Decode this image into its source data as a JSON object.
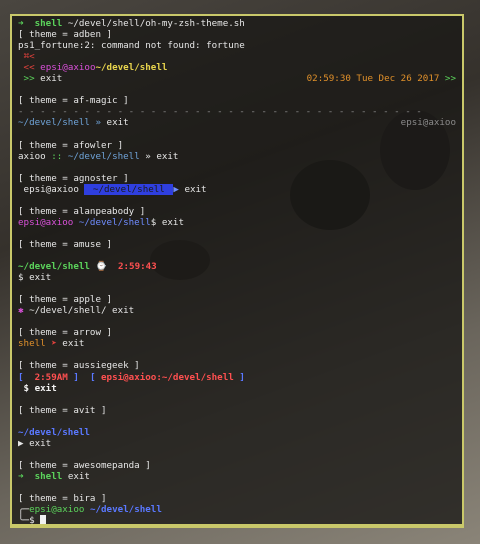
{
  "colors": {
    "frame": "#c9c86a",
    "accent_green": "#5bd35b",
    "accent_blue": "#5a78ff"
  },
  "lines": [
    {
      "segs": [
        {
          "t": "➜  ",
          "c": "g"
        },
        {
          "t": "shell",
          "c": "gb"
        },
        {
          "t": " ~/devel/shell/oh-my-zsh-theme.sh",
          "c": "w"
        }
      ]
    },
    {
      "segs": [
        {
          "t": "[ theme = adben ]",
          "c": "w"
        }
      ]
    },
    {
      "segs": [
        {
          "t": "ps1_fortune:2: command not found: fortune",
          "c": "w"
        }
      ]
    },
    {
      "segs": [
        {
          "t": " ",
          "c": "w"
        },
        {
          "t": "⌘<",
          "c": "r"
        }
      ]
    },
    {
      "segs": [
        {
          "t": " ",
          "c": "w"
        },
        {
          "t": "<<",
          "c": "r"
        },
        {
          "t": " epsi@axioo",
          "c": "m"
        },
        {
          "t": "~/devel/shell",
          "c": "y"
        }
      ]
    },
    {
      "segs": [
        {
          "t": " ",
          "c": "w"
        },
        {
          "t": ">>",
          "c": "g"
        },
        {
          "t": " exit",
          "c": "w"
        }
      ],
      "right": [
        {
          "t": "02:59:30 Tue Dec 26 2017",
          "c": "o"
        },
        {
          "t": " >>",
          "c": "g"
        }
      ]
    },
    {
      "segs": []
    },
    {
      "segs": [
        {
          "t": "[ theme = af-magic ]",
          "c": "w"
        }
      ]
    },
    {
      "segs": [
        {
          "t": "- - - - - - - - - - - - - - - - - - - - - - - - - - - - - - - - - - - - -",
          "c": "gr"
        }
      ]
    },
    {
      "segs": [
        {
          "t": "~/devel/shell",
          "c": "c"
        },
        {
          "t": " » ",
          "c": "c"
        },
        {
          "t": "exit",
          "c": "w"
        }
      ],
      "right": [
        {
          "t": "epsi@axioo",
          "c": "gr"
        }
      ]
    },
    {
      "segs": []
    },
    {
      "segs": [
        {
          "t": "[ theme = afowler ]",
          "c": "w"
        }
      ]
    },
    {
      "segs": [
        {
          "t": "axioo",
          "c": "w"
        },
        {
          "t": " :: ",
          "c": "g"
        },
        {
          "t": "~/devel/shell",
          "c": "c"
        },
        {
          "t": " » exit",
          "c": "w"
        }
      ]
    },
    {
      "segs": []
    },
    {
      "segs": [
        {
          "t": "[ theme = agnoster ]",
          "c": "w"
        }
      ]
    },
    {
      "segs": [
        {
          "t": " epsi@axioo ",
          "c": "w"
        },
        {
          "t": " ~/devel/shell ",
          "c": "seg"
        },
        {
          "t": "▶",
          "c": "bl"
        },
        {
          "t": " exit",
          "c": "w"
        }
      ]
    },
    {
      "segs": []
    },
    {
      "segs": [
        {
          "t": "[ theme = alanpeabody ]",
          "c": "w"
        }
      ]
    },
    {
      "segs": [
        {
          "t": "epsi@axioo",
          "c": "m"
        },
        {
          "t": " ~/devel/shell",
          "c": "bl"
        },
        {
          "t": "$ exit",
          "c": "w"
        }
      ]
    },
    {
      "segs": []
    },
    {
      "segs": [
        {
          "t": "[ theme = amuse ]",
          "c": "w"
        }
      ]
    },
    {
      "segs": []
    },
    {
      "segs": [
        {
          "t": "~/devel/shell",
          "c": "gb"
        },
        {
          "t": " ⌚ ",
          "c": "w"
        },
        {
          "t": " 2:59:43",
          "c": "rb"
        }
      ]
    },
    {
      "segs": [
        {
          "t": "$ exit",
          "c": "w"
        }
      ]
    },
    {
      "segs": []
    },
    {
      "segs": [
        {
          "t": "[ theme = apple ]",
          "c": "w"
        }
      ]
    },
    {
      "segs": [
        {
          "t": "✱",
          "c": "m"
        },
        {
          "t": " ~/devel/shell/ exit",
          "c": "w"
        }
      ]
    },
    {
      "segs": []
    },
    {
      "segs": [
        {
          "t": "[ theme = arrow ]",
          "c": "w"
        }
      ]
    },
    {
      "segs": [
        {
          "t": "shell",
          "c": "o"
        },
        {
          "t": " ➤ ",
          "c": "r"
        },
        {
          "t": "exit",
          "c": "w"
        }
      ]
    },
    {
      "segs": []
    },
    {
      "segs": [
        {
          "t": "[ theme = aussiegeek ]",
          "c": "w"
        }
      ]
    },
    {
      "segs": [
        {
          "t": "[ ",
          "c": "b"
        },
        {
          "t": " 2:59AM",
          "c": "rb"
        },
        {
          "t": " ]  [ ",
          "c": "b"
        },
        {
          "t": "epsi@axioo:~/devel/shell",
          "c": "rb"
        },
        {
          "t": " ]",
          "c": "b"
        }
      ]
    },
    {
      "segs": [
        {
          "t": " $ exit",
          "c": "wb"
        }
      ]
    },
    {
      "segs": []
    },
    {
      "segs": [
        {
          "t": "[ theme = avit ]",
          "c": "w"
        }
      ]
    },
    {
      "segs": []
    },
    {
      "segs": [
        {
          "t": "~/devel/shell",
          "c": "b"
        }
      ]
    },
    {
      "segs": [
        {
          "t": "▶ ",
          "c": "w"
        },
        {
          "t": "exit",
          "c": "w"
        }
      ]
    },
    {
      "segs": []
    },
    {
      "segs": [
        {
          "t": "[ theme = awesomepanda ]",
          "c": "w"
        }
      ]
    },
    {
      "segs": [
        {
          "t": "➜  ",
          "c": "g"
        },
        {
          "t": "shell",
          "c": "gb"
        },
        {
          "t": " exit",
          "c": "w"
        }
      ]
    },
    {
      "segs": []
    },
    {
      "segs": [
        {
          "t": "[ theme = bira ]",
          "c": "w"
        }
      ]
    },
    {
      "segs": [
        {
          "t": "╭─",
          "c": "w"
        },
        {
          "t": "epsi@axioo",
          "c": "g"
        },
        {
          "t": " ~/devel/shell",
          "c": "b"
        }
      ]
    },
    {
      "segs": [
        {
          "t": "╰─$ ",
          "c": "w"
        }
      ],
      "cursor": true
    }
  ]
}
